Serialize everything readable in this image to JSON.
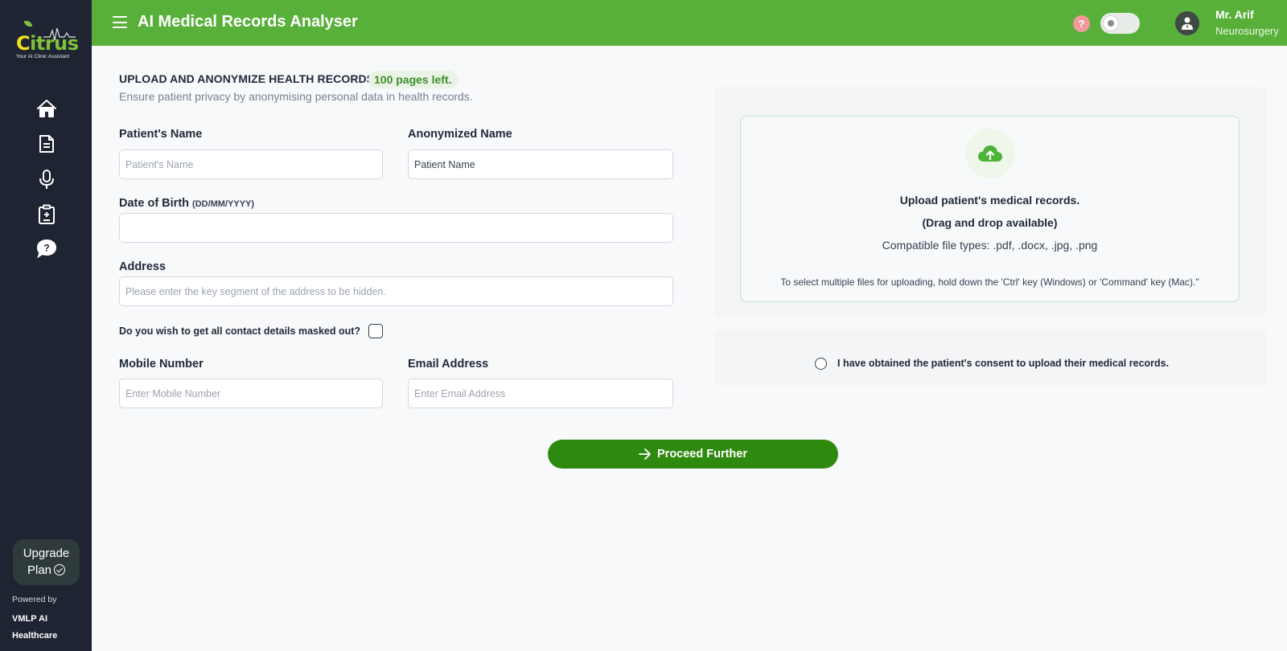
{
  "brand": {
    "logo_text_first": "C",
    "logo_text_rest": "itrus",
    "tagline": "Your AI Clinic Assistant",
    "powered_by_label": "Powered by",
    "powered_by_name": "VMLP AI Healthcare",
    "accent_color": "#58b03b",
    "sidebar_color": "#1e2432"
  },
  "sidebar": {
    "items": [
      {
        "icon": "home-icon"
      },
      {
        "icon": "document-icon"
      },
      {
        "icon": "microphone-icon"
      },
      {
        "icon": "clipboard-icon"
      },
      {
        "icon": "help-chat-icon"
      }
    ],
    "upgrade_line1": "Upgrade",
    "upgrade_line2": "Plan"
  },
  "header": {
    "title": "AI Medical Records Analyser",
    "help_glyph": "?",
    "user_name": "Mr. Arif",
    "user_dept": "Neurosurgery"
  },
  "main": {
    "title": "UPLOAD AND ANONYMIZE HEALTH RECORDS",
    "pages_left": "100 pages left.",
    "subtitle": "Ensure patient privacy by anonymising personal data in health records.",
    "patient_name_label": "Patient's Name",
    "patient_name_placeholder": "Patient's Name",
    "patient_name_value": "",
    "anonymized_name_label": "Anonymized Name",
    "anonymized_name_value": "Patient Name",
    "dob_label": "Date of Birth",
    "dob_format": "(DD/MM/YYYY)",
    "dob_value": "",
    "address_label": "Address",
    "address_placeholder": "Please enter the key segment of the address to be hidden.",
    "mask_question": "Do you wish to get all contact details masked out?",
    "mask_checked": false,
    "mobile_label": "Mobile Number",
    "mobile_placeholder": "Enter Mobile Number",
    "email_label": "Email Address",
    "email_placeholder": "Enter Email Address",
    "proceed_label": "Proceed Further"
  },
  "upload": {
    "title": "Upload patient's medical records.",
    "drag_note": "(Drag and drop available)",
    "file_types": "Compatible file types: .pdf, .docx, .jpg, .png",
    "multi_hint": "To select multiple files for uploading, hold down the 'Ctrl' key (Windows) or 'Command' key (Mac).\"",
    "icon": "cloud-upload-icon"
  },
  "consent": {
    "text": "I have obtained the patient's consent to upload their medical records.",
    "checked": false
  }
}
